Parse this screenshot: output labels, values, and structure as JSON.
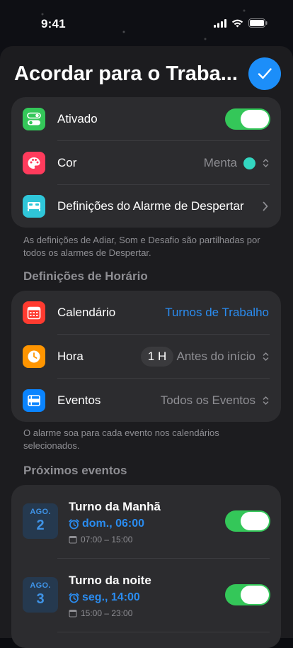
{
  "status": {
    "time": "9:41"
  },
  "header": {
    "title": "Acordar para o Traba..."
  },
  "main_settings": {
    "enabled_label": "Ativado",
    "color_label": "Cor",
    "color_value": "Menta",
    "color_swatch": "#33d6c0",
    "wake_alarm_label": "Definições do Alarme de Despertar"
  },
  "main_note": "As definições de Adiar, Som e Desafio são partilhadas por todos os alarmes de Despertar.",
  "schedule": {
    "heading": "Definições de Horário",
    "calendar_label": "Calendário",
    "calendar_value": "Turnos de Trabalho",
    "time_label": "Hora",
    "time_offset": "1 H",
    "time_value": "Antes do início",
    "events_label": "Eventos",
    "events_value": "Todos os Eventos"
  },
  "schedule_note": "O alarme soa para cada evento nos calendários selecionados.",
  "upcoming": {
    "heading": "Próximos eventos",
    "events": [
      {
        "month": "AGO.",
        "day": "2",
        "title": "Turno da Manhã",
        "alarm": "dom., 06:00",
        "range": "07:00 – 15:00",
        "enabled": true
      },
      {
        "month": "AGO.",
        "day": "3",
        "title": "Turno da noite",
        "alarm": "seg., 14:00",
        "range": "15:00 – 23:00",
        "enabled": true
      }
    ]
  },
  "colors": {
    "accent": "#1c8ef9",
    "toggle_on": "#34c759",
    "link": "#2a8cf0"
  }
}
